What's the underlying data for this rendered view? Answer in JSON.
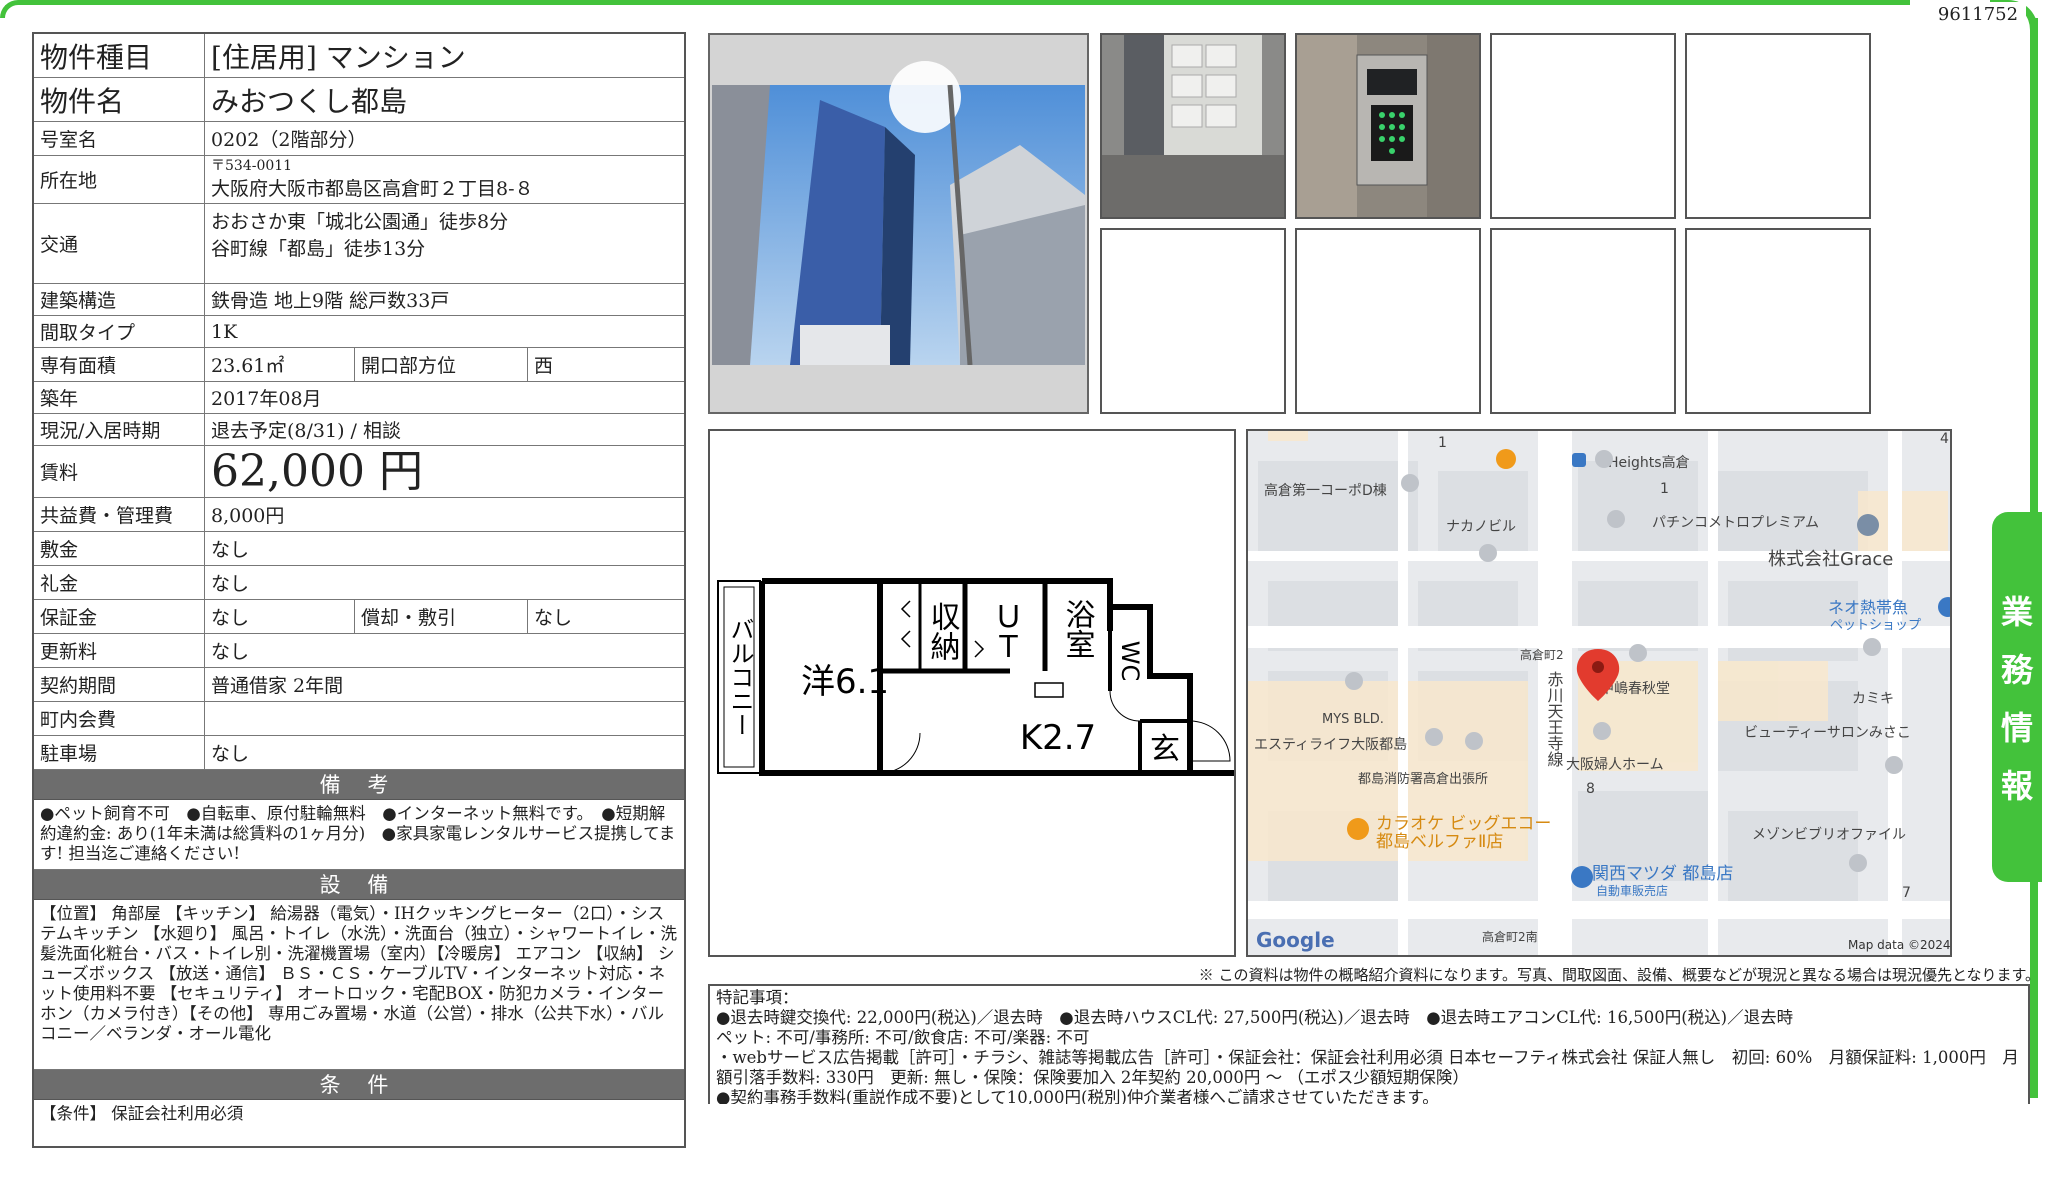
{
  "doc_id": "9611752",
  "side_tab": [
    "業",
    "務",
    "情",
    "報"
  ],
  "property": {
    "type_label": "物件種目",
    "type_value": "[住居用] マンション",
    "name_label": "物件名",
    "name_value": "みおつくし都島",
    "room_label": "号室名",
    "room_value": "0202（2階部分）",
    "address_label": "所在地",
    "postal": "〒534-0011",
    "address_value": "大阪府大阪市都島区高倉町２丁目8-８",
    "transport_label": "交通",
    "transport_1": "おおさか東「城北公園通」徒歩8分",
    "transport_2": "谷町線「都島」徒歩13分",
    "structure_label": "建築構造",
    "structure_value": "鉄骨造 地上9階 総戸数33戸",
    "layout_label": "間取タイプ",
    "layout_value": "1K",
    "area_label": "専有面積",
    "area_value": "23.61㎡",
    "direction_label": "開口部方位",
    "direction_value": "西",
    "built_label": "築年",
    "built_value": "2017年08月",
    "status_label": "現況/入居時期",
    "status_value": "退去予定(8/31) / 相談",
    "rent_label": "賃料",
    "rent_value": "62,000 円",
    "fee_label": "共益費・管理費",
    "fee_value": "8,000円",
    "deposit_label": "敷金",
    "deposit_value": "なし",
    "key_money_label": "礼金",
    "key_money_value": "なし",
    "guarantee_label": "保証金",
    "guarantee_value": "なし",
    "amort_label": "償却・敷引",
    "amort_value": "なし",
    "renewal_label": "更新料",
    "renewal_value": "なし",
    "contract_label": "契約期間",
    "contract_value": "普通借家 2年間",
    "town_fee_label": "町内会費",
    "town_fee_value": "",
    "parking_label": "駐車場",
    "parking_value": "なし"
  },
  "remarks": {
    "title": "備 考",
    "text": "●ペット飼育不可　●自転車、原付駐輪無料　●インターネット無料です。　●短期解約違約金: あり(1年未満は総賃料の1ヶ月分)　●家具家電レンタルサービス提携してます! 担当迄ご連絡ください!"
  },
  "equipment": {
    "title": "設 備",
    "text": "【位置】 角部屋 【キッチン】 給湯器（電気）・IHクッキングヒーター（2口）・システムキッチン 【水廻り】 風呂・トイレ（水洗）・洗面台（独立）・シャワートイレ・洗髪洗面化粧台・バス・トイレ別・洗濯機置場（室内）【冷暖房】 エアコン 【収納】 シューズボックス 【放送・通信】 ＢＳ・ＣＳ・ケーブルTV・インターネット対応・ネット使用料不要 【セキュリティ】 オートロック・宅配BOX・防犯カメラ・インターホン（カメラ付き）【その他】 専用ごみ置場・水道（公営）・排水（公共下水）・バルコニー／ベランダ・オール電化"
  },
  "conditions": {
    "title": "条 件",
    "text": "【条件】 保証会社利用必須"
  },
  "floorplan": {
    "balcony": "バルコニー",
    "western_room": "洋6.1",
    "storage": "収納",
    "ut": "ＵＴ",
    "bath": "浴室",
    "wc": "WC",
    "kitchen": "K2.7",
    "entrance": "玄"
  },
  "map": {
    "labels": [
      "高倉第一コーポD棟",
      "ナカノビル",
      "Heights高倉",
      "パチンコメトロプレミアム",
      "株式会社Grace",
      "ネオ熱帯魚",
      "ペットショップ",
      "高倉町2",
      "中嶋春秋堂",
      "カミキ",
      "MYS BLD.",
      "エスティライフ大阪都島",
      "赤川天王寺線",
      "大阪婦人ホーム",
      "ビューティーサロンみさこ",
      "都島消防署高倉出張所",
      "カラオケ ビッグエコー",
      "都島ベルファⅡ店",
      "メゾンビブリオファイル",
      "関西マツダ 都島店",
      "自動車販売店",
      "高倉町2南"
    ],
    "numbers": [
      "1",
      "1",
      "8",
      "7",
      "4"
    ],
    "google": "Google",
    "attribution": "Map data ©2024"
  },
  "disclaimer": "※ この資料は物件の概略紹介資料になります。写真、間取図面、設備、概要などが現況と異なる場合は現況優先となります。",
  "notes": {
    "title": "特記事項：",
    "line1": "●退去時鍵交換代: 22,000円(税込)／退去時　●退去時ハウスCL代: 27,500円(税込)／退去時　●退去時エアコンCL代: 16,500円(税込)／退去時",
    "line2": "ペット: 不可/事務所: 不可/飲食店: 不可/楽器: 不可",
    "line3": "・webサービス広告掲載［許可］・チラシ、雑誌等掲載広告［許可］・保証会社：保証会社利用必須 日本セーフティ株式会社 保証人無し　初回: 60%　月額保証料: 1,000円　月額引落手数料: 330円　更新: 無し・保険：保険要加入 2年契約 20,000円 ～ （エポス少額短期保険）",
    "line4": "●契約事務手数料(重説作成不要)として10,000円(税別)仲介業者様へご請求させていただきます。"
  },
  "colors": {
    "accent": "#43c23b",
    "section_header": "#6d6d6d",
    "map_pin": "#e23b2e"
  }
}
